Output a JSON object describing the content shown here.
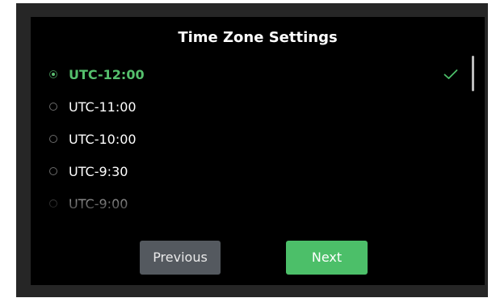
{
  "title": "Time Zone Settings",
  "timezones": [
    {
      "label": "UTC-12:00",
      "selected": true
    },
    {
      "label": "UTC-11:00",
      "selected": false
    },
    {
      "label": "UTC-10:00",
      "selected": false
    },
    {
      "label": "UTC-9:30",
      "selected": false
    },
    {
      "label": "UTC-9:00",
      "selected": false
    }
  ],
  "buttons": {
    "previous": "Previous",
    "next": "Next"
  },
  "colors": {
    "accent": "#4cbf69",
    "secondary_button": "#54595f",
    "background": "#000000",
    "bezel": "#262626"
  },
  "icons": {
    "selected_check": "check-icon",
    "radio": "radio-icon"
  }
}
